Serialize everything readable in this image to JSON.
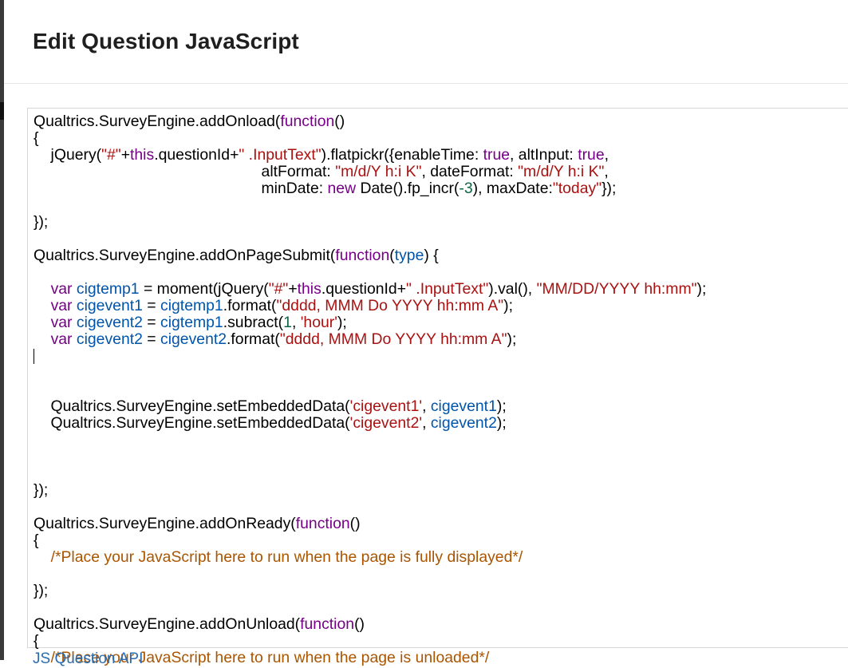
{
  "dialog": {
    "title": "Edit Question JavaScript"
  },
  "code_lines": [
    [
      [
        "Qualtrics.SurveyEngine.addOnload(",
        ""
      ],
      [
        "function",
        "kw"
      ],
      [
        "()",
        ""
      ]
    ],
    [
      [
        "{",
        ""
      ]
    ],
    [
      [
        "    jQuery(",
        ""
      ],
      [
        "\"#\"",
        "str"
      ],
      [
        "+",
        ""
      ],
      [
        "this",
        "kw"
      ],
      [
        ".questionId+",
        ""
      ],
      [
        "\" .InputText\"",
        "str"
      ],
      [
        ").flatpickr({enableTime: ",
        ""
      ],
      [
        "true",
        "kw"
      ],
      [
        ", altInput: ",
        ""
      ],
      [
        "true",
        "kw"
      ],
      [
        ",",
        ""
      ]
    ],
    [
      [
        "                                                     altFormat: ",
        ""
      ],
      [
        "\"m/d/Y h:i K\"",
        "str"
      ],
      [
        ", dateFormat: ",
        ""
      ],
      [
        "\"m/d/Y h:i K\"",
        "str"
      ],
      [
        ",",
        ""
      ]
    ],
    [
      [
        "                                                     minDate: ",
        ""
      ],
      [
        "new",
        "kw"
      ],
      [
        " Date().fp_incr(",
        ""
      ],
      [
        "-3",
        "num"
      ],
      [
        "), maxDate:",
        ""
      ],
      [
        "\"today\"",
        "str"
      ],
      [
        "});",
        ""
      ]
    ],
    [],
    [
      [
        "});",
        ""
      ]
    ],
    [],
    [
      [
        "Qualtrics.SurveyEngine.addOnPageSubmit(",
        ""
      ],
      [
        "function",
        "kw"
      ],
      [
        "(",
        ""
      ],
      [
        "type",
        "var"
      ],
      [
        ") {",
        ""
      ]
    ],
    [],
    [
      [
        "    ",
        ""
      ],
      [
        "var",
        "kw"
      ],
      [
        " ",
        ""
      ],
      [
        "cigtemp1",
        "var"
      ],
      [
        " = moment(jQuery(",
        ""
      ],
      [
        "\"#\"",
        "str"
      ],
      [
        "+",
        ""
      ],
      [
        "this",
        "kw"
      ],
      [
        ".questionId+",
        ""
      ],
      [
        "\" .InputText\"",
        "str"
      ],
      [
        ").val(), ",
        ""
      ],
      [
        "\"MM/DD/YYYY hh:mm\"",
        "str"
      ],
      [
        ");",
        ""
      ]
    ],
    [
      [
        "    ",
        ""
      ],
      [
        "var",
        "kw"
      ],
      [
        " ",
        ""
      ],
      [
        "cigevent1",
        "var"
      ],
      [
        " = ",
        ""
      ],
      [
        "cigtemp1",
        "var"
      ],
      [
        ".format(",
        ""
      ],
      [
        "\"dddd, MMM Do YYYY hh:mm A\"",
        "str"
      ],
      [
        ");",
        ""
      ]
    ],
    [
      [
        "    ",
        ""
      ],
      [
        "var",
        "kw"
      ],
      [
        " ",
        ""
      ],
      [
        "cigevent2",
        "var"
      ],
      [
        " = ",
        ""
      ],
      [
        "cigtemp1",
        "var"
      ],
      [
        ".subract(",
        ""
      ],
      [
        "1",
        "num"
      ],
      [
        ", ",
        ""
      ],
      [
        "'hour'",
        "str"
      ],
      [
        ");",
        ""
      ]
    ],
    [
      [
        "    ",
        ""
      ],
      [
        "var",
        "kw"
      ],
      [
        " ",
        ""
      ],
      [
        "cigevent2",
        "var"
      ],
      [
        " = ",
        ""
      ],
      [
        "cigevent2",
        "var"
      ],
      [
        ".format(",
        ""
      ],
      [
        "\"dddd, MMM Do YYYY hh:mm A\"",
        "str"
      ],
      [
        ");",
        ""
      ]
    ],
    [],
    [],
    [],
    [
      [
        "    Qualtrics.SurveyEngine.setEmbeddedData(",
        ""
      ],
      [
        "'cigevent1'",
        "str"
      ],
      [
        ", ",
        ""
      ],
      [
        "cigevent1",
        "var"
      ],
      [
        ");",
        ""
      ]
    ],
    [
      [
        "    Qualtrics.SurveyEngine.setEmbeddedData(",
        ""
      ],
      [
        "'cigevent2'",
        "str"
      ],
      [
        ", ",
        ""
      ],
      [
        "cigevent2",
        "var"
      ],
      [
        ");",
        ""
      ]
    ],
    [],
    [],
    [],
    [
      [
        "});",
        ""
      ]
    ],
    [],
    [
      [
        "Qualtrics.SurveyEngine.addOnReady(",
        ""
      ],
      [
        "function",
        "kw"
      ],
      [
        "()",
        ""
      ]
    ],
    [
      [
        "{",
        ""
      ]
    ],
    [
      [
        "    ",
        ""
      ],
      [
        "/*Place your JavaScript here to run when the page is fully displayed*/",
        "com"
      ]
    ],
    [],
    [
      [
        "});",
        ""
      ]
    ],
    [],
    [
      [
        "Qualtrics.SurveyEngine.addOnUnload(",
        ""
      ],
      [
        "function",
        "kw"
      ],
      [
        "()",
        ""
      ]
    ],
    [
      [
        "{",
        ""
      ]
    ],
    [
      [
        "    ",
        ""
      ],
      [
        "/*Place your JavaScript here to run when the page is unloaded*/",
        "com"
      ]
    ]
  ],
  "footer": {
    "link_label": "JS Question API"
  }
}
